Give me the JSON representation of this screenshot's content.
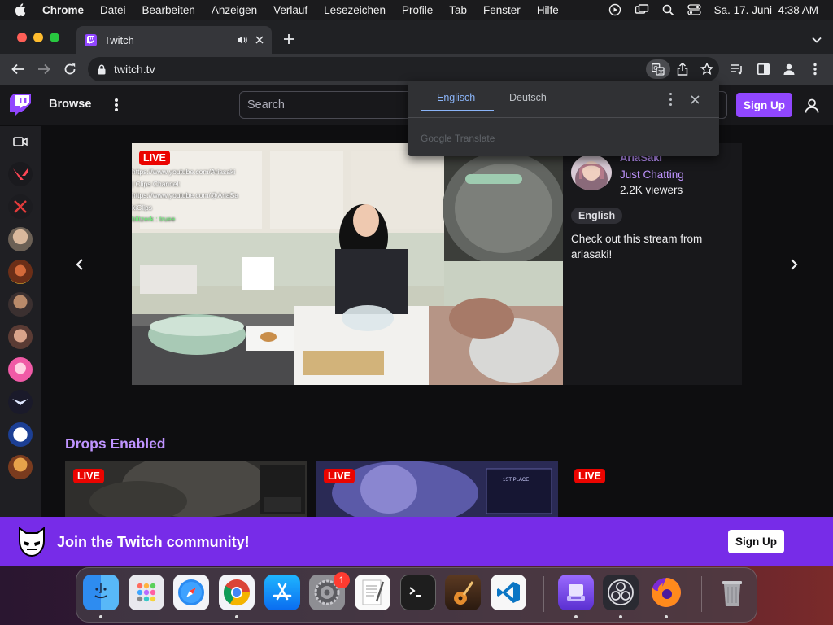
{
  "menubar": {
    "app": "Chrome",
    "items": [
      "Datei",
      "Bearbeiten",
      "Anzeigen",
      "Verlauf",
      "Lesezeichen",
      "Profile",
      "Tab",
      "Fenster",
      "Hilfe"
    ],
    "clock": "Sa. 17. Juni  4:38 AM"
  },
  "browser": {
    "tab_title": "Twitch",
    "url": "twitch.tv"
  },
  "translate_popup": {
    "tabs": [
      "Englisch",
      "Deutsch"
    ],
    "brand": "Google Translate"
  },
  "twitch": {
    "browse": "Browse",
    "search_placeholder": "Search",
    "signup": "Sign Up",
    "featured": {
      "live": "LIVE",
      "streamer": "AriaSaki",
      "category": "Just Chatting",
      "viewers": "2.2K viewers",
      "tag": "English",
      "description": "Check out this stream from ariasaki!",
      "overlay_lines": [
        "https://www.youtube.com/Ariasaki",
        "| Clips Channel:",
        "https://www.youtube.com/@AriaSa",
        "kiClips",
        "blitzerk : truee"
      ]
    },
    "drops_title": "Drops Enabled",
    "cards": [
      {
        "live": "LIVE"
      },
      {
        "live": "LIVE",
        "overlay": "1ST PLACE"
      },
      {
        "live": "LIVE"
      }
    ],
    "banner": {
      "text": "Join the Twitch community!",
      "signup": "Sign Up"
    }
  },
  "dock": {
    "badge": "1",
    "icons": [
      "finder-icon",
      "launchpad-icon",
      "safari-icon",
      "chrome-icon",
      "app-store-icon",
      "system-settings-icon",
      "textedit-icon",
      "terminal-icon",
      "garageband-icon",
      "vscode-icon",
      "backup-icon",
      "obs-icon",
      "firefox-icon",
      "trash-icon"
    ]
  },
  "colors": {
    "twitch_purple": "#9147ff",
    "banner_purple": "#772ce8",
    "live_red": "#eb0400",
    "accent_text": "#bf94ff"
  }
}
